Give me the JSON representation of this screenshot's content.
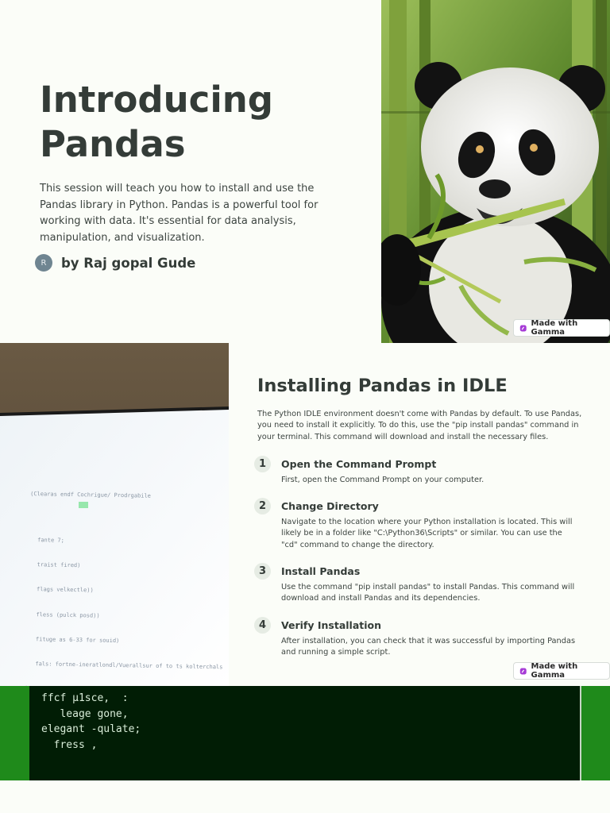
{
  "slide1": {
    "title": "Introducing Pandas",
    "body": "This session will teach you how to install and use the Pandas library in Python. Pandas is a powerful tool for working with data. It's essential for data analysis, manipulation, and visualization.",
    "avatar_letter": "R",
    "author": "by Raj gopal Gude",
    "badge": "Made with Gamma"
  },
  "slide2": {
    "title": "Installing Pandas in IDLE",
    "intro": "The Python IDLE environment doesn't come with Pandas by default. To use Pandas, you need to install it explicitly. To do this, use the \"pip install pandas\" command in your terminal. This command will download and install the necessary files.",
    "steps": [
      {
        "num": "1",
        "title": "Open the Command Prompt",
        "desc": "First, open the Command Prompt on your computer."
      },
      {
        "num": "2",
        "title": "Change Directory",
        "desc": "Navigate to the location where your Python installation is located. This will likely be in a folder like \"C:\\Python36\\Scripts\" or similar. You can use the \"cd\" command to change the directory."
      },
      {
        "num": "3",
        "title": "Install Pandas",
        "desc": "Use the command \"pip install pandas\" to install Pandas. This command will download and install Pandas and its dependencies."
      },
      {
        "num": "4",
        "title": "Verify Installation",
        "desc": "After installation, you can check that it was successful by importing Pandas and running a simple script."
      }
    ],
    "badge": "Made with Gamma",
    "screen_lines": [
      "(Clearas endf Cochrigue/ Prodrgabile",
      "fante 7;",
      "traist fired)",
      "flags velkectle))",
      "fless (pulck posd))",
      "fituge as 6-33 for souid)",
      "fals: fortne-ineratlondl/Vuerallsur of to ts kolterchals",
      "}"
    ]
  },
  "slide3": {
    "code_lines": [
      "ffcf µ1sce,  :",
      "   leage gone,",
      "elegant -qulate;",
      "  fress ,"
    ]
  },
  "colors": {
    "background": "#fbfdf8",
    "text": "#343c38",
    "avatar": "#6f8591",
    "terminal": "#011d05",
    "terminal_border": "#1f8a1b"
  }
}
